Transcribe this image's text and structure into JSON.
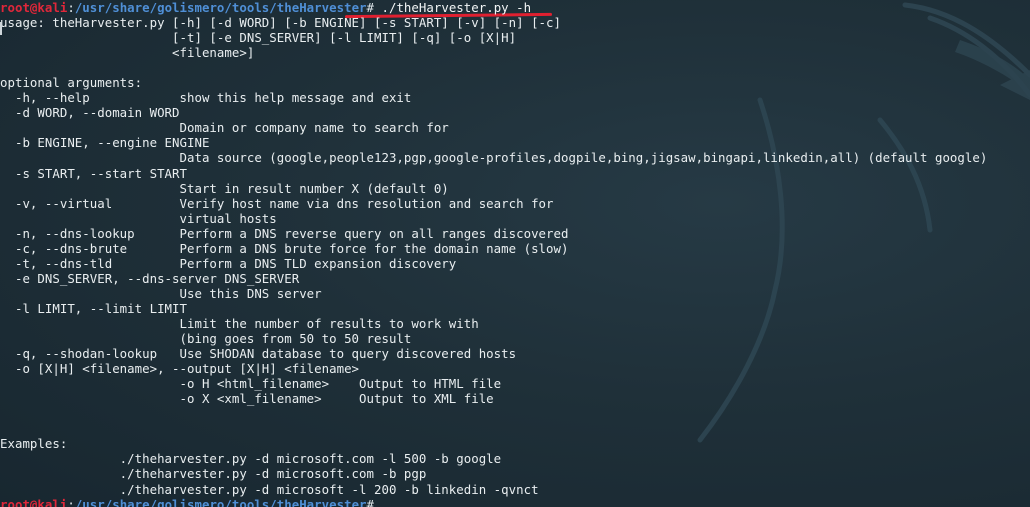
{
  "prompt": {
    "user_host": "root@kali",
    "path": "/usr/share/golismero/tools/theHarvester",
    "symbol": "#",
    "command": " ./theHarvester.py -h"
  },
  "output_lines": [
    "usage: theHarvester.py [-h] [-d WORD] [-b ENGINE] [-s START] [-v] [-n] [-c]",
    "                       [-t] [-e DNS_SERVER] [-l LIMIT] [-q] [-o [X|H]",
    "                       <filename>]",
    "",
    "optional arguments:",
    "  -h, --help            show this help message and exit",
    "  -d WORD, --domain WORD",
    "                        Domain or company name to search for",
    "  -b ENGINE, --engine ENGINE",
    "                        Data source (google,people123,pgp,google-profiles,dogpile,bing,jigsaw,bingapi,linkedin,all) (default google)",
    "  -s START, --start START",
    "                        Start in result number X (default 0)",
    "  -v, --virtual         Verify host name via dns resolution and search for",
    "                        virtual hosts",
    "  -n, --dns-lookup      Perform a DNS reverse query on all ranges discovered",
    "  -c, --dns-brute       Perform a DNS brute force for the domain name (slow)",
    "  -t, --dns-tld         Perform a DNS TLD expansion discovery",
    "  -e DNS_SERVER, --dns-server DNS_SERVER",
    "                        Use this DNS server",
    "  -l LIMIT, --limit LIMIT",
    "                        Limit the number of results to work with",
    "                        (bing goes from 50 to 50 result",
    "  -q, --shodan-lookup   Use SHODAN database to query discovered hosts",
    "  -o [X|H] <filename>, --output [X|H] <filename>",
    "                        -o H <html_filename>    Output to HTML file",
    "                        -o X <xml_filename>     Output to XML file",
    "",
    "",
    "Examples:",
    "                ./theharvester.py -d microsoft.com -l 500 -b google",
    "                ./theharvester.py -d microsoft.com -b pgp",
    "                ./theharvester.py -d microsoft -l 200 -b linkedin -qvnct"
  ],
  "final_prompt": {
    "user_host": "root@kali",
    "path": "/usr/share/golismero/tools/theHarvester",
    "symbol": "#"
  },
  "colors": {
    "background": "#1f3039",
    "prompt_user": "#e0273a",
    "prompt_path": "#4f8fd6",
    "text": "#e9eef0",
    "underline": "#e02030"
  },
  "icons": {
    "background_logo": "kali-dragon-icon"
  }
}
